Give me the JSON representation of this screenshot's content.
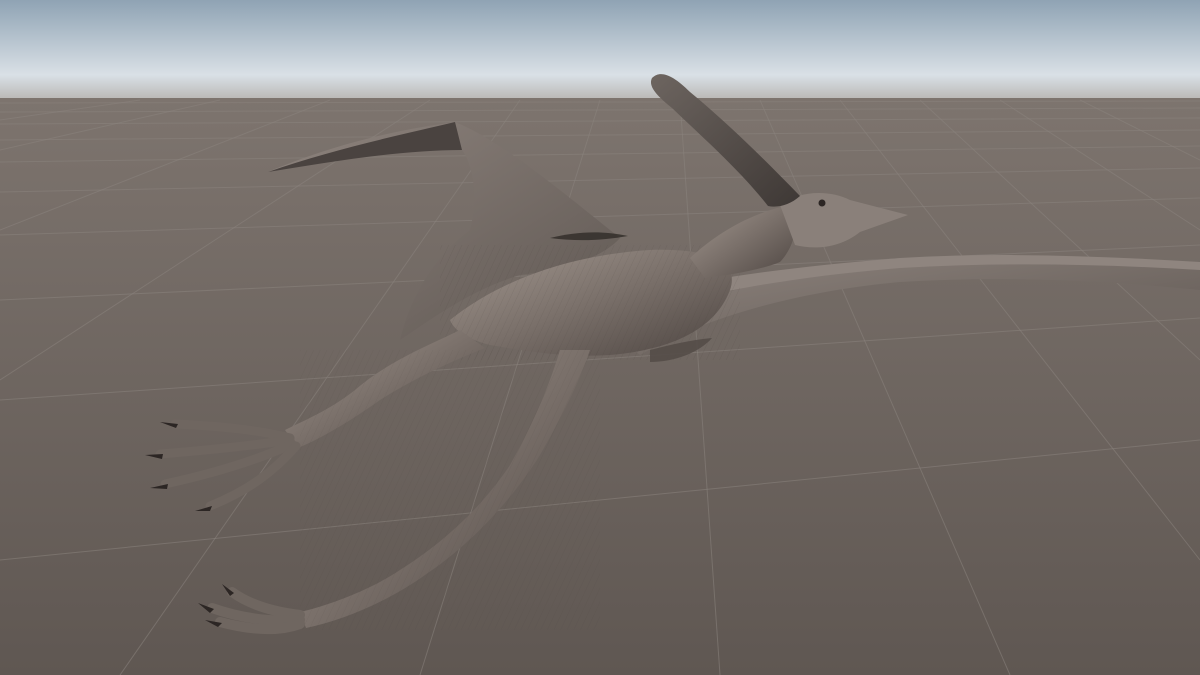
{
  "scene": {
    "description_visible_text": "",
    "colors": {
      "sky_top": "#8fa3b4",
      "sky_horizon": "#dfe5ea",
      "ground_far": "#7a716b",
      "ground_near": "#625a55",
      "grid_line": "#8d847e",
      "creature_skin_light": "#9b918a",
      "creature_skin_mid": "#6f6660",
      "creature_skin_dark": "#3f3936",
      "claw": "#2c2624"
    },
    "objects": [
      {
        "name": "pterosaur-model",
        "kind": "3d-model"
      },
      {
        "name": "ground-grid",
        "kind": "reference-grid"
      },
      {
        "name": "skybox",
        "kind": "environment"
      }
    ]
  }
}
